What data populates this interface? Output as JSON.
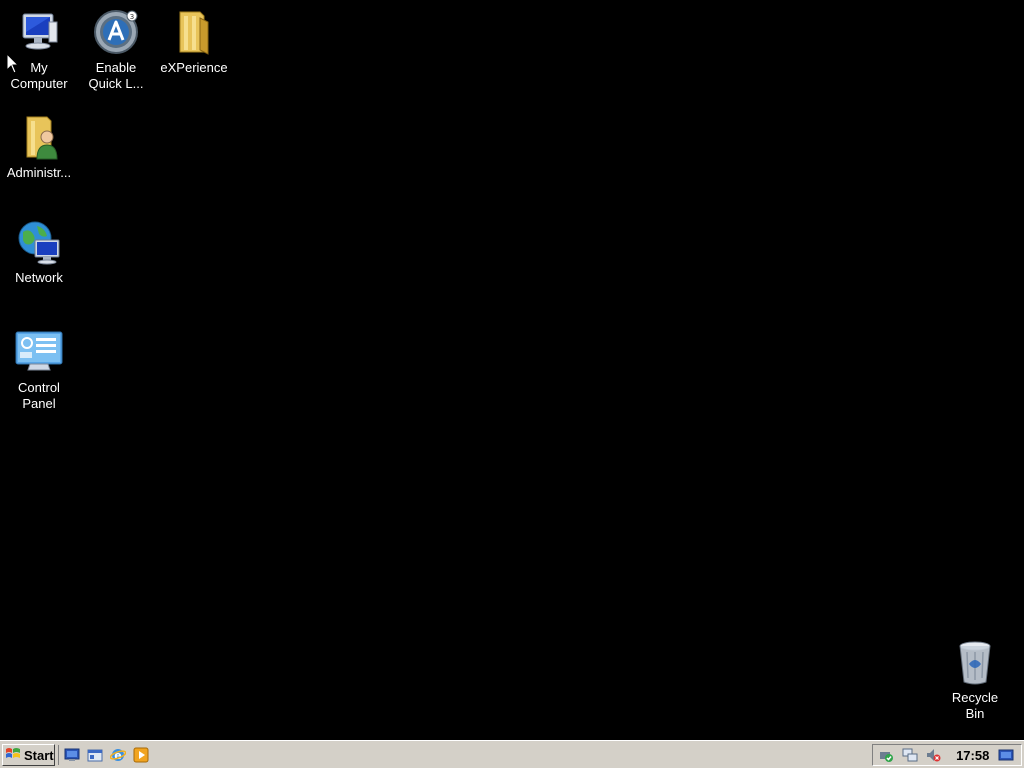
{
  "desktop": {
    "background_color": "#000000",
    "icons": {
      "my_computer": {
        "label": "My\nComputer",
        "icon": "computer-icon"
      },
      "enable_quick": {
        "label": "Enable\nQuick L...",
        "icon": "autoit-icon"
      },
      "experience": {
        "label": "eXPerience",
        "icon": "folder-icon"
      },
      "administrator": {
        "label": "Administr...",
        "icon": "user-folder-icon"
      },
      "network": {
        "label": "Network",
        "icon": "network-icon"
      },
      "control_panel": {
        "label": "Control\nPanel",
        "icon": "control-panel-icon"
      },
      "recycle_bin": {
        "label": "Recycle\nBin",
        "icon": "recycle-bin-icon"
      }
    }
  },
  "taskbar": {
    "start_label": "Start",
    "quick_launch": [
      "show-desktop-icon",
      "explorer-icon",
      "internet-explorer-icon",
      "media-player-icon"
    ],
    "tray": {
      "icons": [
        "safely-remove-icon",
        "network-status-icon",
        "volume-muted-icon"
      ],
      "clock": "17:58",
      "show_desktop": "desktop-icon"
    }
  }
}
